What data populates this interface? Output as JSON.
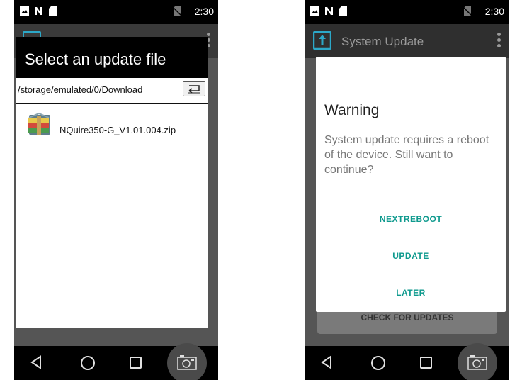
{
  "status_bar": {
    "time": "2:30"
  },
  "app_bar": {
    "title": "System Update"
  },
  "file_dialog": {
    "title": "Select an update file",
    "path": "/storage/emulated/0/Download",
    "files": [
      {
        "name": "NQuire350-G_V1.01.004.zip"
      }
    ]
  },
  "warning_dialog": {
    "title": "Warning",
    "message": "System update requires a reboot of the device. Still want to continue?",
    "buttons": {
      "next_reboot": "NEXTREBOOT",
      "update": "UPDATE",
      "later": "LATER"
    }
  },
  "main": {
    "check_button": "CHECK FOR UPDATES"
  },
  "colors": {
    "accent": "#0f9a8e",
    "app_icon": "#2ca8c8"
  }
}
